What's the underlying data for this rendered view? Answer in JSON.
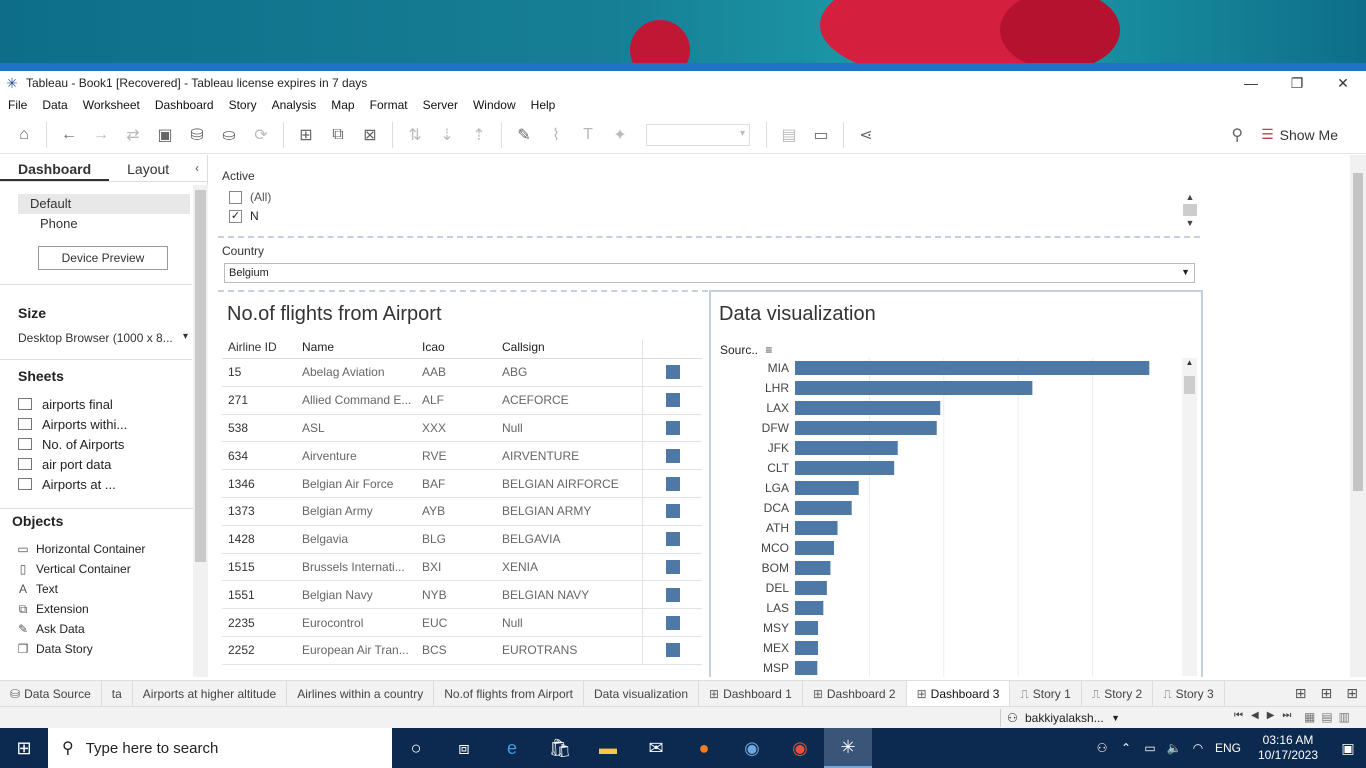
{
  "window": {
    "title": "Tableau - Book1 [Recovered] - Tableau license expires in 7 days",
    "minimize_icon": "minimize-icon",
    "restore_icon": "restore-icon",
    "close_icon": "close-icon"
  },
  "menu": [
    "File",
    "Data",
    "Worksheet",
    "Dashboard",
    "Story",
    "Analysis",
    "Map",
    "Format",
    "Server",
    "Window",
    "Help"
  ],
  "toolbar": {
    "show_me_label": "Show Me"
  },
  "left_pane": {
    "tabs": [
      "Dashboard",
      "Layout"
    ],
    "devices": [
      "Default",
      "Phone"
    ],
    "device_preview_label": "Device Preview",
    "size_title": "Size",
    "size_value": "Desktop Browser (1000 x 8...",
    "sheets_title": "Sheets",
    "sheets": [
      "airports final",
      "Airports withi...",
      "No. of Airports",
      "air port data",
      "Airports at ..."
    ],
    "objects_title": "Objects",
    "objects": [
      {
        "label": "Horizontal Container",
        "icon": "horizontal-container-icon",
        "glyph": "▭"
      },
      {
        "label": "Vertical Container",
        "icon": "vertical-container-icon",
        "glyph": "▯"
      },
      {
        "label": "Text",
        "icon": "text-icon",
        "glyph": "A"
      },
      {
        "label": "Extension",
        "icon": "extension-icon",
        "glyph": "⧉"
      },
      {
        "label": "Ask Data",
        "icon": "ask-data-icon",
        "glyph": "✎"
      },
      {
        "label": "Data Story",
        "icon": "data-story-icon",
        "glyph": "❐"
      }
    ]
  },
  "filters": {
    "active": {
      "title": "Active",
      "options": [
        {
          "label": "(All)",
          "checked": false
        },
        {
          "label": "N",
          "checked": true
        }
      ]
    },
    "country": {
      "title": "Country",
      "value": "Belgium"
    }
  },
  "flights_panel": {
    "title": "No.of flights from Airport",
    "columns": [
      "Airline ID",
      "Name",
      "Icao",
      "Callsign"
    ],
    "rows": [
      {
        "id": "15",
        "name": "Abelag Aviation",
        "icao": "AAB",
        "callsign": "ABG"
      },
      {
        "id": "271",
        "name": "Allied Command E...",
        "icao": "ALF",
        "callsign": "ACEFORCE"
      },
      {
        "id": "538",
        "name": "ASL",
        "icao": "XXX",
        "callsign": "Null"
      },
      {
        "id": "634",
        "name": "Airventure",
        "icao": "RVE",
        "callsign": "AIRVENTURE"
      },
      {
        "id": "1346",
        "name": "Belgian Air Force",
        "icao": "BAF",
        "callsign": "BELGIAN AIRFORCE"
      },
      {
        "id": "1373",
        "name": "Belgian Army",
        "icao": "AYB",
        "callsign": "BELGIAN ARMY"
      },
      {
        "id": "1428",
        "name": "Belgavia",
        "icao": "BLG",
        "callsign": "BELGAVIA"
      },
      {
        "id": "1515",
        "name": "Brussels Internati...",
        "icao": "BXI",
        "callsign": "XENIA"
      },
      {
        "id": "1551",
        "name": "Belgian Navy",
        "icao": "NYB",
        "callsign": "BELGIAN NAVY"
      },
      {
        "id": "2235",
        "name": "Eurocontrol",
        "icao": "EUC",
        "callsign": "Null"
      },
      {
        "id": "2252",
        "name": "European Air Tran...",
        "icao": "BCS",
        "callsign": "EUROTRANS"
      }
    ]
  },
  "viz_panel": {
    "title": "Data visualization",
    "axis_label": "Sourc.."
  },
  "chart_data": {
    "type": "bar",
    "orientation": "horizontal",
    "title": "Data visualization",
    "ylabel": "Sourc..",
    "categories": [
      "MIA",
      "LHR",
      "LAX",
      "DFW",
      "JFK",
      "CLT",
      "LGA",
      "DCA",
      "ATH",
      "MCO",
      "BOM",
      "DEL",
      "LAS",
      "MSY",
      "MEX",
      "MSP"
    ],
    "values": [
      100,
      67,
      41,
      40,
      29,
      28,
      18,
      16,
      12,
      11,
      10,
      9,
      8,
      6.5,
      6.5,
      6.3
    ],
    "xlim": [
      0,
      105
    ],
    "color": "#4e79a7"
  },
  "sheet_tabs": [
    {
      "label": "Data Source",
      "icon": "data-source-icon",
      "glyph": "⛁",
      "active": false
    },
    {
      "label": "ta",
      "icon": "",
      "glyph": "",
      "active": false
    },
    {
      "label": "Airports at higher altitude",
      "icon": "",
      "glyph": "",
      "active": false
    },
    {
      "label": "Airlines within a country",
      "icon": "",
      "glyph": "",
      "active": false
    },
    {
      "label": "No.of flights from Airport",
      "icon": "",
      "glyph": "",
      "active": false
    },
    {
      "label": "Data visualization",
      "icon": "",
      "glyph": "",
      "active": false
    },
    {
      "label": "Dashboard 1",
      "icon": "dashboard-icon",
      "glyph": "⊞",
      "active": false
    },
    {
      "label": "Dashboard 2",
      "icon": "dashboard-icon",
      "glyph": "⊞",
      "active": false
    },
    {
      "label": "Dashboard 3",
      "icon": "dashboard-icon",
      "glyph": "⊞",
      "active": true
    },
    {
      "label": "Story 1",
      "icon": "story-icon",
      "glyph": "⎍",
      "active": false
    },
    {
      "label": "Story 2",
      "icon": "story-icon",
      "glyph": "⎍",
      "active": false
    },
    {
      "label": "Story 3",
      "icon": "story-icon",
      "glyph": "⎍",
      "active": false
    }
  ],
  "status": {
    "user": "bakkiyalaksh..."
  },
  "taskbar": {
    "search_placeholder": "Type here to search",
    "language": "ENG",
    "time": "03:16 AM",
    "date": "10/17/2023"
  }
}
